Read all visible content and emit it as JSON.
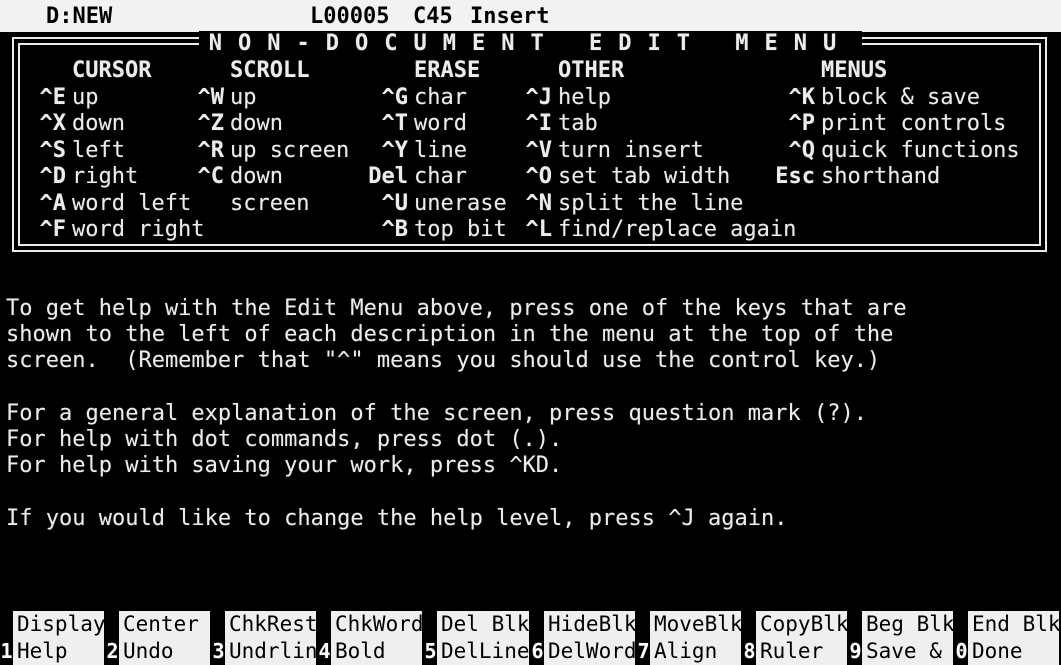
{
  "status": {
    "file": "D:NEW",
    "line": "L00005",
    "col": "C45",
    "mode": "Insert"
  },
  "menu": {
    "title": "NON-DOCUMENT EDIT MENU",
    "headers": {
      "cursor": "CURSOR",
      "scroll": "SCROLL",
      "erase": "ERASE",
      "other": "OTHER",
      "menus": "MENUS"
    },
    "cursor": [
      {
        "key": "^E",
        "desc": "up"
      },
      {
        "key": "^X",
        "desc": "down"
      },
      {
        "key": "^S",
        "desc": "left"
      },
      {
        "key": "^D",
        "desc": "right"
      },
      {
        "key": "^A",
        "desc": "word left"
      },
      {
        "key": "^F",
        "desc": "word right"
      }
    ],
    "scroll": [
      {
        "key": "^W",
        "desc": "up"
      },
      {
        "key": "^Z",
        "desc": "down"
      },
      {
        "key": "^R",
        "desc": "up screen"
      },
      {
        "key": "^C",
        "desc": "down"
      },
      {
        "key": "",
        "desc": "screen"
      }
    ],
    "erase": [
      {
        "key": "^G",
        "desc": "char"
      },
      {
        "key": "^T",
        "desc": "word"
      },
      {
        "key": "^Y",
        "desc": "line"
      },
      {
        "key": "Del",
        "desc": "char"
      },
      {
        "key": "^U",
        "desc": "unerase"
      },
      {
        "key": "^B",
        "desc": "top bit"
      }
    ],
    "other": [
      {
        "key": "^J",
        "desc": "help"
      },
      {
        "key": "^I",
        "desc": "tab"
      },
      {
        "key": "^V",
        "desc": "turn insert"
      },
      {
        "key": "^O",
        "desc": "set tab width"
      },
      {
        "key": "^N",
        "desc": "split the line"
      },
      {
        "key": "^L",
        "desc": "find/replace again"
      }
    ],
    "menus": [
      {
        "key": "^K",
        "desc": "block & save"
      },
      {
        "key": "^P",
        "desc": "print controls"
      },
      {
        "key": "^Q",
        "desc": "quick functions"
      },
      {
        "key": "Esc",
        "desc": "shorthand"
      }
    ]
  },
  "help": {
    "para1": [
      "To get help with the Edit Menu above, press one of the keys that are",
      "shown to the left of each description in the menu at the top of the",
      "screen.  (Remember that \"^\" means you should use the control key.)"
    ],
    "para2": [
      "For a general explanation of the screen, press question mark (?).",
      "For help with dot commands, press dot (.).",
      "For help with saving your work, press ^KD."
    ],
    "para3": "If you would like to change the help level, press ^J again."
  },
  "fkeys": [
    {
      "num": "1",
      "top": "Display",
      "bottom": "Help"
    },
    {
      "num": "2",
      "top": "Center",
      "bottom": "Undo"
    },
    {
      "num": "3",
      "top": "ChkRest",
      "bottom": "Undrlin"
    },
    {
      "num": "4",
      "top": "ChkWord",
      "bottom": "Bold"
    },
    {
      "num": "5",
      "top": "Del Blk",
      "bottom": "DelLine"
    },
    {
      "num": "6",
      "top": "HideBlk",
      "bottom": "DelWord"
    },
    {
      "num": "7",
      "top": "MoveBlk",
      "bottom": "Align"
    },
    {
      "num": "8",
      "top": "CopyBlk",
      "bottom": "Ruler"
    },
    {
      "num": "9",
      "top": "Beg Blk",
      "bottom": "Save &"
    },
    {
      "num": "0",
      "top": "End Blk",
      "bottom": "Done"
    }
  ]
}
